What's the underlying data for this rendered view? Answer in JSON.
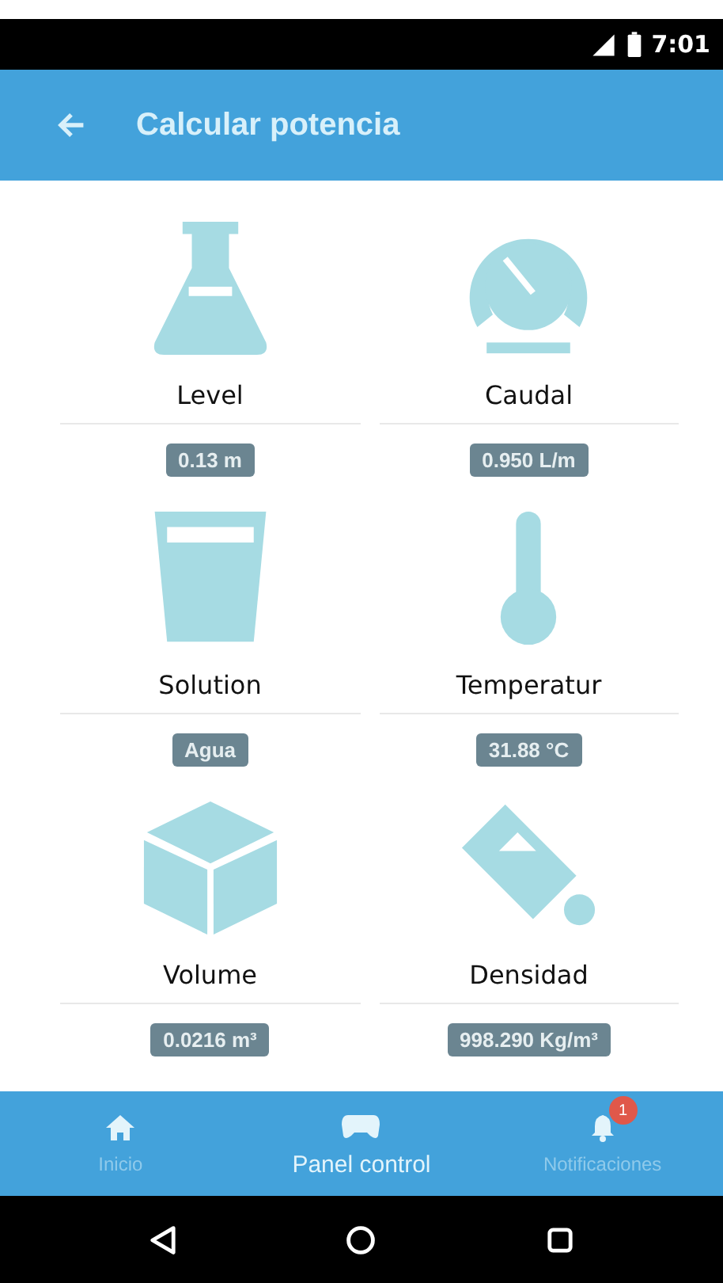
{
  "status_bar": {
    "time": "7:01"
  },
  "app_bar": {
    "title": "Calcular potencia"
  },
  "cards": [
    {
      "kind": "flask",
      "label": "Level",
      "value": "0.13 m"
    },
    {
      "kind": "gauge",
      "label": "Caudal",
      "value": "0.950 L/m"
    },
    {
      "kind": "glass",
      "label": "Solution",
      "value": "Agua"
    },
    {
      "kind": "thermometer",
      "label": "Temperatur",
      "value": "31.88 °C"
    },
    {
      "kind": "cube",
      "label": "Volume",
      "value": "0.0216 m³"
    },
    {
      "kind": "bucket",
      "label": "Densidad",
      "value": "998.290 Kg/m³"
    }
  ],
  "bottom_nav": [
    {
      "kind": "home",
      "label": "Inicio",
      "selected": false
    },
    {
      "kind": "gamepad",
      "label": "Panel control",
      "selected": true
    },
    {
      "kind": "bell",
      "label": "Notificaciones",
      "selected": false,
      "badge": "1"
    }
  ]
}
